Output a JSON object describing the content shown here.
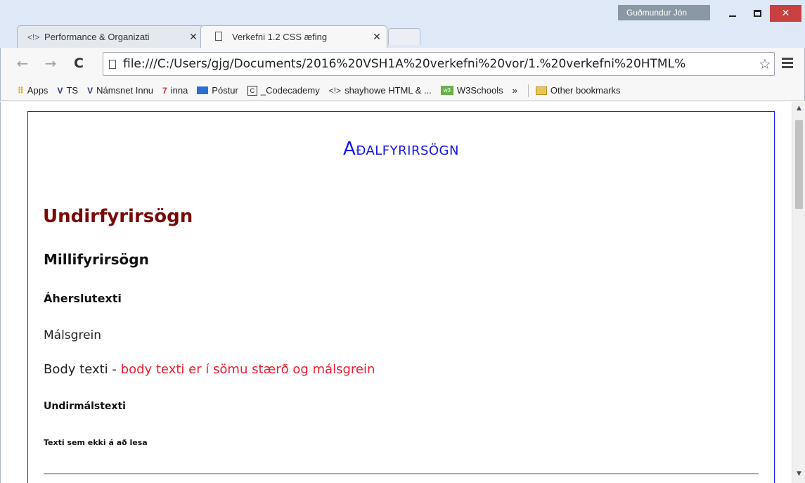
{
  "window": {
    "user": "Guðmundur Jón",
    "minimize_label": "",
    "maximize_label": "",
    "close_label": "✕"
  },
  "tabs": [
    {
      "icon": "<!>",
      "title": "Performance & Organizati",
      "close": "✕"
    },
    {
      "title": "Verkefni 1.2 CSS æfing",
      "close": "✕"
    }
  ],
  "toolbar": {
    "back": "←",
    "forward": "→",
    "reload": "C",
    "url": "file:///C:/Users/gjg/Documents/2016%20VSH1A%20verkefni%20vor/1.%20verkefni%20HTML%",
    "star": "☆"
  },
  "bookmarks": {
    "items": [
      {
        "icon": "⠿",
        "label": "Apps"
      },
      {
        "icon": "V",
        "label": "TS"
      },
      {
        "icon": "V",
        "label": "Námsnet Innu"
      },
      {
        "icon": "7",
        "label": "inna"
      },
      {
        "icon": "",
        "label": "Póstur"
      },
      {
        "icon": "C",
        "label": "_Codecademy"
      },
      {
        "icon": "<!>",
        "label": "shayhowe HTML & ..."
      },
      {
        "icon": "w3",
        "label": "W3Schools"
      }
    ],
    "overflow": "»",
    "other": "Other bookmarks"
  },
  "page": {
    "h1": "Aðalfyrirsögn",
    "h2": "Undirfyrirsögn",
    "h3": "Millifyrirsögn",
    "h4": "Áherslutexti",
    "p1": "Málsgrein",
    "p2_black": "Body texti - ",
    "p2_red": "body texti er í sömu stærð og málsgrein",
    "small1": "Undirmálstexti",
    "small2": "Texti sem ekki á að lesa"
  },
  "scrollbar": {
    "up": "▲",
    "down": "▼"
  }
}
